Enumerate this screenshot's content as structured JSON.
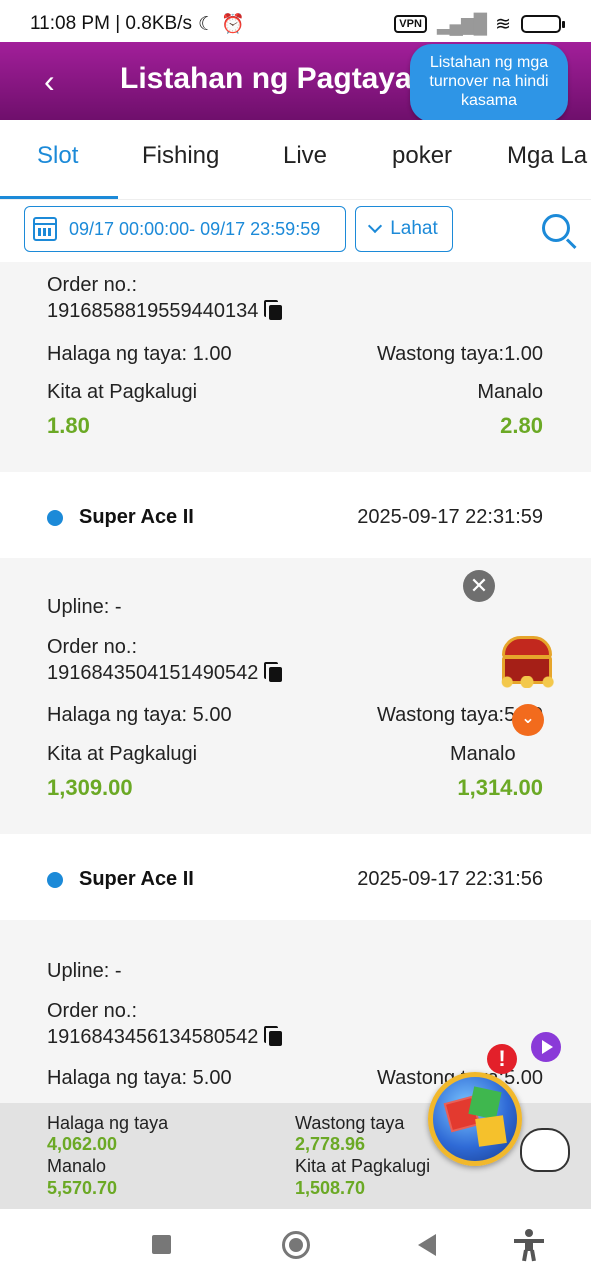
{
  "status_bar": {
    "time_speed": "11:08 PM | 0.8KB/s",
    "moon_icon": "☾",
    "alarm_icon": "⏰",
    "vpn": "VPN",
    "signal": "▂▄▆█",
    "wifi": "≋",
    "battery": "⚡"
  },
  "header": {
    "back_icon": "‹",
    "title": "Listahan ng Pagtaya",
    "turnover_link": "Listahan ng mga turnover na hindi kasama"
  },
  "tabs": [
    "Slot",
    "Fishing",
    "Live",
    "poker",
    "Mga La"
  ],
  "filters": {
    "date_range": "09/17 00:00:00- 09/17 23:59:59",
    "select_value": "Lahat"
  },
  "labels": {
    "upline": "Upline: -",
    "order_no": "Order no.:",
    "bet_amount_prefix": "Halaga ng taya: ",
    "valid_bet_prefix": "Wastong taya:",
    "profit_loss": "Kita at Pagkalugi",
    "win": "Manalo"
  },
  "records": [
    {
      "order_no": "1916858819559440134",
      "bet_amount": "1.00",
      "valid_bet": "1.00",
      "profit_loss": "1.80",
      "win": "2.80"
    },
    {
      "game": "Super Ace II",
      "time": "2025-09-17 22:31:59",
      "order_no": "1916843504151490542",
      "bet_amount": "5.00",
      "valid_bet": "5.00",
      "profit_loss": "1,309.00",
      "win": "1,314.00"
    },
    {
      "game": "Super Ace II",
      "time": "2025-09-17 22:31:56",
      "order_no": "1916843456134580542",
      "bet_amount": "5.00",
      "valid_bet": "5.00"
    }
  ],
  "floating": {
    "close": "✕",
    "down": "⌄",
    "alert": "!"
  },
  "summary": {
    "bet_label": "Halaga ng taya",
    "bet_value": "4,062.00",
    "valid_label": "Wastong taya",
    "valid_value": "2,778.96",
    "win_label": "Manalo",
    "win_value": "5,570.70",
    "profit_label": "Kita at Pagkalugi",
    "profit_value": "1,508.70"
  },
  "colors": {
    "header_gradient_top": "#a21f9a",
    "header_gradient_bottom": "#6f0f6c",
    "accent_blue": "#1c8ad8",
    "value_green": "#6ba925"
  }
}
